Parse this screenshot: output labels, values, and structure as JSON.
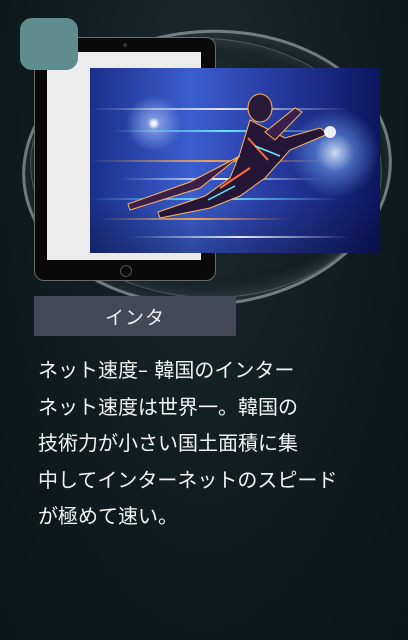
{
  "card": {
    "label": "インタ",
    "body_lines": [
      "ネット速度– 韓国のインター",
      "ネット速度は世界一。韓国の",
      "技術力が小さい国土面積に集",
      "中してインターネットのスピード",
      "が極めて速い。"
    ]
  }
}
